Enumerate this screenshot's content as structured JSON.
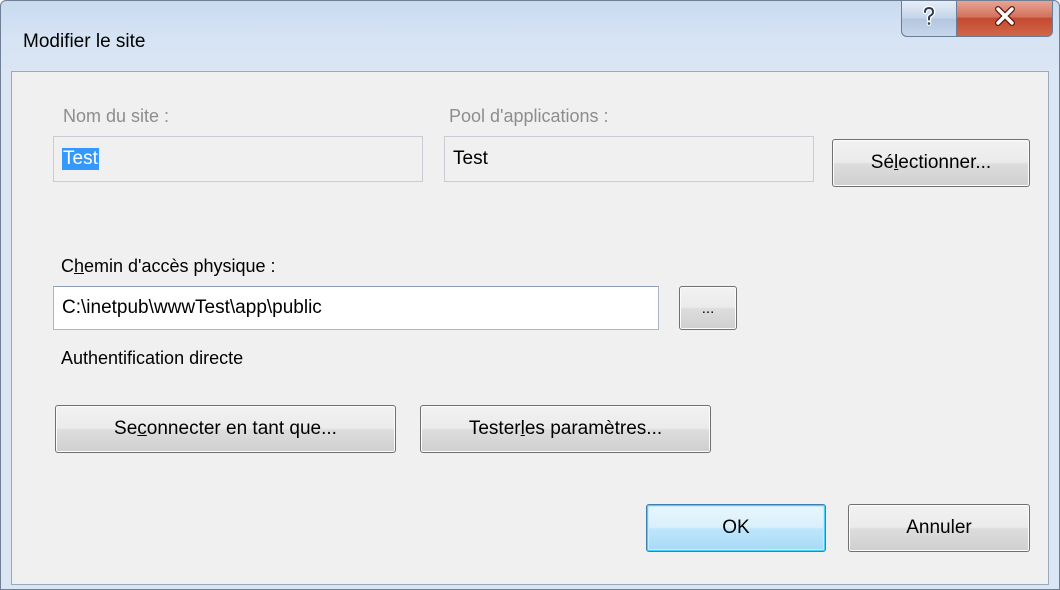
{
  "window": {
    "title": "Modifier le site"
  },
  "form": {
    "site_name_label": "Nom du site :",
    "site_name_value": "Test",
    "app_pool_label": "Pool d'applications :",
    "app_pool_value": "Test",
    "select_button": {
      "pre": "Sé",
      "accel": "l",
      "post": "ectionner..."
    },
    "physical_path_label": {
      "pre": "C",
      "accel": "h",
      "post": "emin d'accès physique :"
    },
    "physical_path_value": "C:\\inetpub\\wwwTest\\app\\public",
    "browse_button": "...",
    "auth_text": "Authentification directe",
    "connect_as_button": {
      "pre": "Se ",
      "accel": "c",
      "post": "onnecter en tant que..."
    },
    "test_settings_button": {
      "pre": "Tester ",
      "accel": "l",
      "post": "es paramètres..."
    }
  },
  "footer": {
    "ok_label": "OK",
    "cancel_label": "Annuler"
  },
  "icons": {
    "help": "question-mark-icon",
    "close": "close-x-icon"
  },
  "colors": {
    "selection": "#3399ff",
    "close_button": "#c44a30",
    "default_button_border": "#3c7fb1"
  }
}
